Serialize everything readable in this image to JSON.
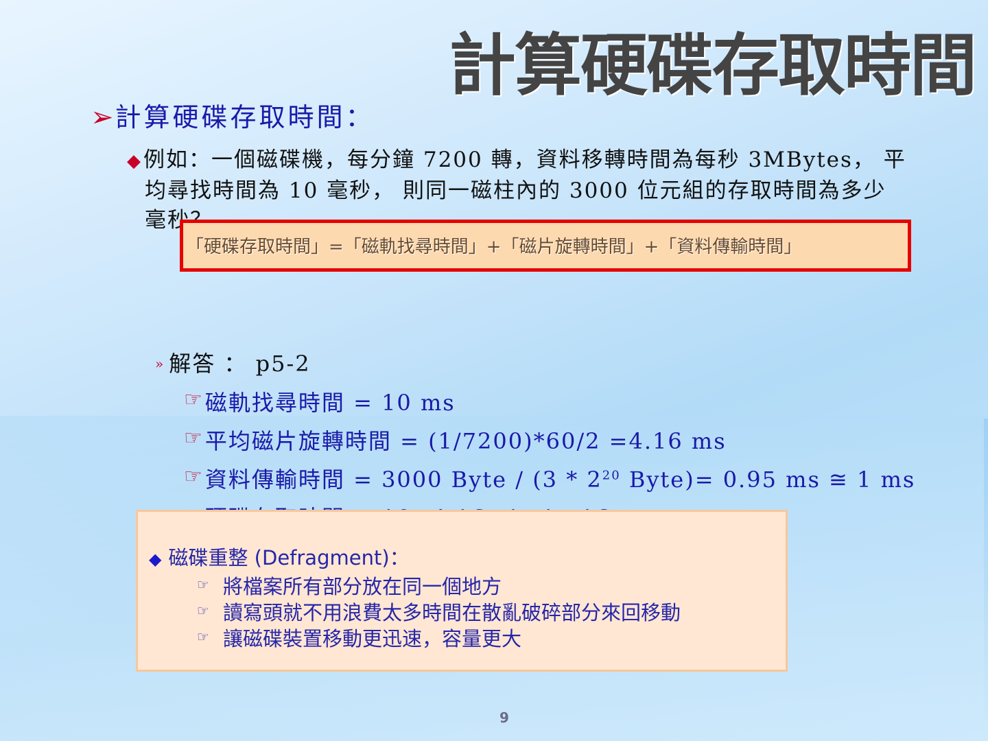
{
  "slide": {
    "title": "計算硬碟存取時間",
    "heading": "計算硬碟存取時間：",
    "paragraph_lines": [
      "例如：一個磁碟機，每分鐘 7200 轉，資料移轉時間為每秒  3MBytes， 平",
      "均尋找時間為 10 毫秒，  則同一磁柱內的 3000 位元組的存取時間為多少",
      "毫秒？"
    ],
    "formula": "「硬碟存取時間」=「磁軌找尋時間」+「磁片旋轉時間」+「資料傳輸時間」",
    "answer": "解答  ： p5-2",
    "rows": [
      "磁軌找尋時間  = 10 ms",
      "平均磁片旋轉時間  = (1/7200)*60/2 =4.16 ms",
      "資料傳輸時間  = 3000 Byte / (3 * 2",
      "硬碟存取時間  = 10+4.16+1=15.16 ms"
    ],
    "row3_sup": "20",
    "row3_tail": " Byte)= 0.95 ms ≅ 1 ms",
    "callout": {
      "heading": "磁碟重整 (Defragment)：",
      "items": [
        "將檔案所有部分放在同一個地方",
        "讀寫頭就不用浪費太多時間在散亂破碎部分來回移動",
        "讓磁碟裝置移動更迅速，容量更大"
      ]
    },
    "page_number": "9"
  },
  "colors": {
    "heading_blue": "#1a1aa8",
    "bullet_red": "#c8002a",
    "formula_border": "#e60000",
    "formula_fill": "#fdd9b0",
    "callout_fill": "#ffe7d3"
  },
  "icons": {
    "heading_bullet": "arrow-bullet-icon",
    "paragraph_bullet": "diamond-bullet-icon",
    "answer_bullet": "chevron-bullet-icon",
    "row_bullet": "pointing-hand-icon"
  }
}
